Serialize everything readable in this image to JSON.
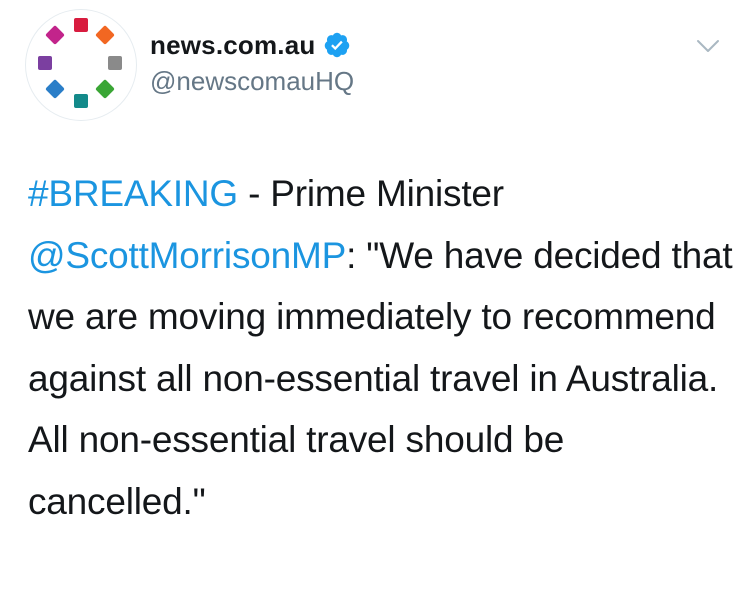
{
  "author": {
    "display_name": "news.com.au",
    "handle": "@newscomauHQ",
    "verified": true,
    "avatar_icon": "news-com-au-logo"
  },
  "menu": {
    "icon": "chevron-down-icon"
  },
  "tweet": {
    "hashtag": "#BREAKING",
    "text_1": " - Prime Minister ",
    "mention": "@ScottMorrisonMP",
    "text_2": ": \"We have decided that we are moving immediately to recommend against all non-essential travel in Australia. All non-essential travel should be cancelled.\""
  },
  "colors": {
    "link": "#1b95e0",
    "verified": "#1da1f2",
    "handle": "#657786",
    "text": "#14171a",
    "logo_red": "#d81c3f",
    "logo_orange": "#f26722",
    "logo_gray": "#8a8a8a",
    "logo_green": "#3aa635",
    "logo_teal": "#138a8a",
    "logo_blue": "#2a7ec8",
    "logo_purple": "#7b3fa0",
    "logo_magenta": "#c2248b"
  }
}
